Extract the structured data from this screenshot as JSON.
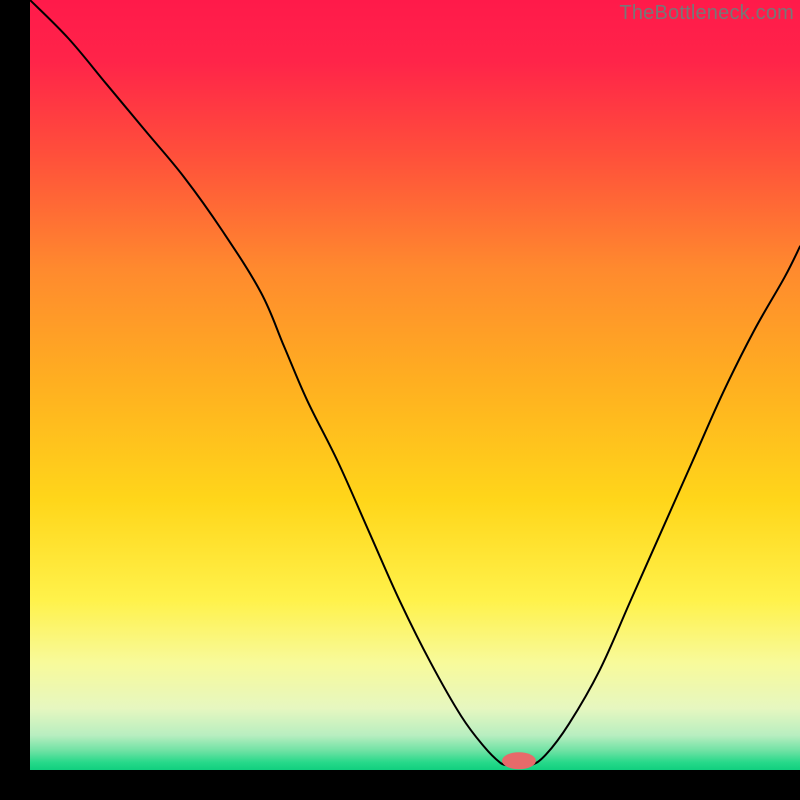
{
  "watermark": "TheBottleneck.com",
  "chart_data": {
    "type": "line",
    "title": "",
    "xlabel": "",
    "ylabel": "",
    "xlim": [
      0,
      100
    ],
    "ylim": [
      0,
      100
    ],
    "grid": false,
    "legend": false,
    "background_gradient": {
      "stops": [
        {
          "offset": 0.0,
          "color": "#ff1a4a"
        },
        {
          "offset": 0.08,
          "color": "#ff2449"
        },
        {
          "offset": 0.2,
          "color": "#ff4f3b"
        },
        {
          "offset": 0.35,
          "color": "#ff8a2e"
        },
        {
          "offset": 0.5,
          "color": "#ffb020"
        },
        {
          "offset": 0.65,
          "color": "#ffd61a"
        },
        {
          "offset": 0.78,
          "color": "#fff24b"
        },
        {
          "offset": 0.86,
          "color": "#f8fa9a"
        },
        {
          "offset": 0.92,
          "color": "#e6f7c0"
        },
        {
          "offset": 0.955,
          "color": "#b8eec0"
        },
        {
          "offset": 0.975,
          "color": "#6fe2a4"
        },
        {
          "offset": 0.99,
          "color": "#27d98a"
        },
        {
          "offset": 1.0,
          "color": "#10cf7f"
        }
      ]
    },
    "annotations": [
      {
        "type": "pill",
        "x": 63.5,
        "y": 1.2,
        "rx": 2.2,
        "ry": 1.1,
        "color": "#e76a6a"
      }
    ],
    "series": [
      {
        "name": "bottleneck-curve",
        "color": "#000000",
        "stroke_width": 2,
        "x": [
          0,
          5,
          10,
          15,
          20,
          25,
          30,
          33,
          36,
          40,
          44,
          48,
          52,
          56,
          59,
          61,
          62,
          63,
          65,
          67,
          70,
          74,
          78,
          82,
          86,
          90,
          94,
          98,
          100
        ],
        "values": [
          100,
          95,
          89,
          83,
          77,
          70,
          62,
          55,
          48,
          40,
          31,
          22,
          14,
          7,
          3,
          1,
          0.6,
          0.5,
          0.6,
          2,
          6,
          13,
          22,
          31,
          40,
          49,
          57,
          64,
          68
        ]
      }
    ]
  }
}
